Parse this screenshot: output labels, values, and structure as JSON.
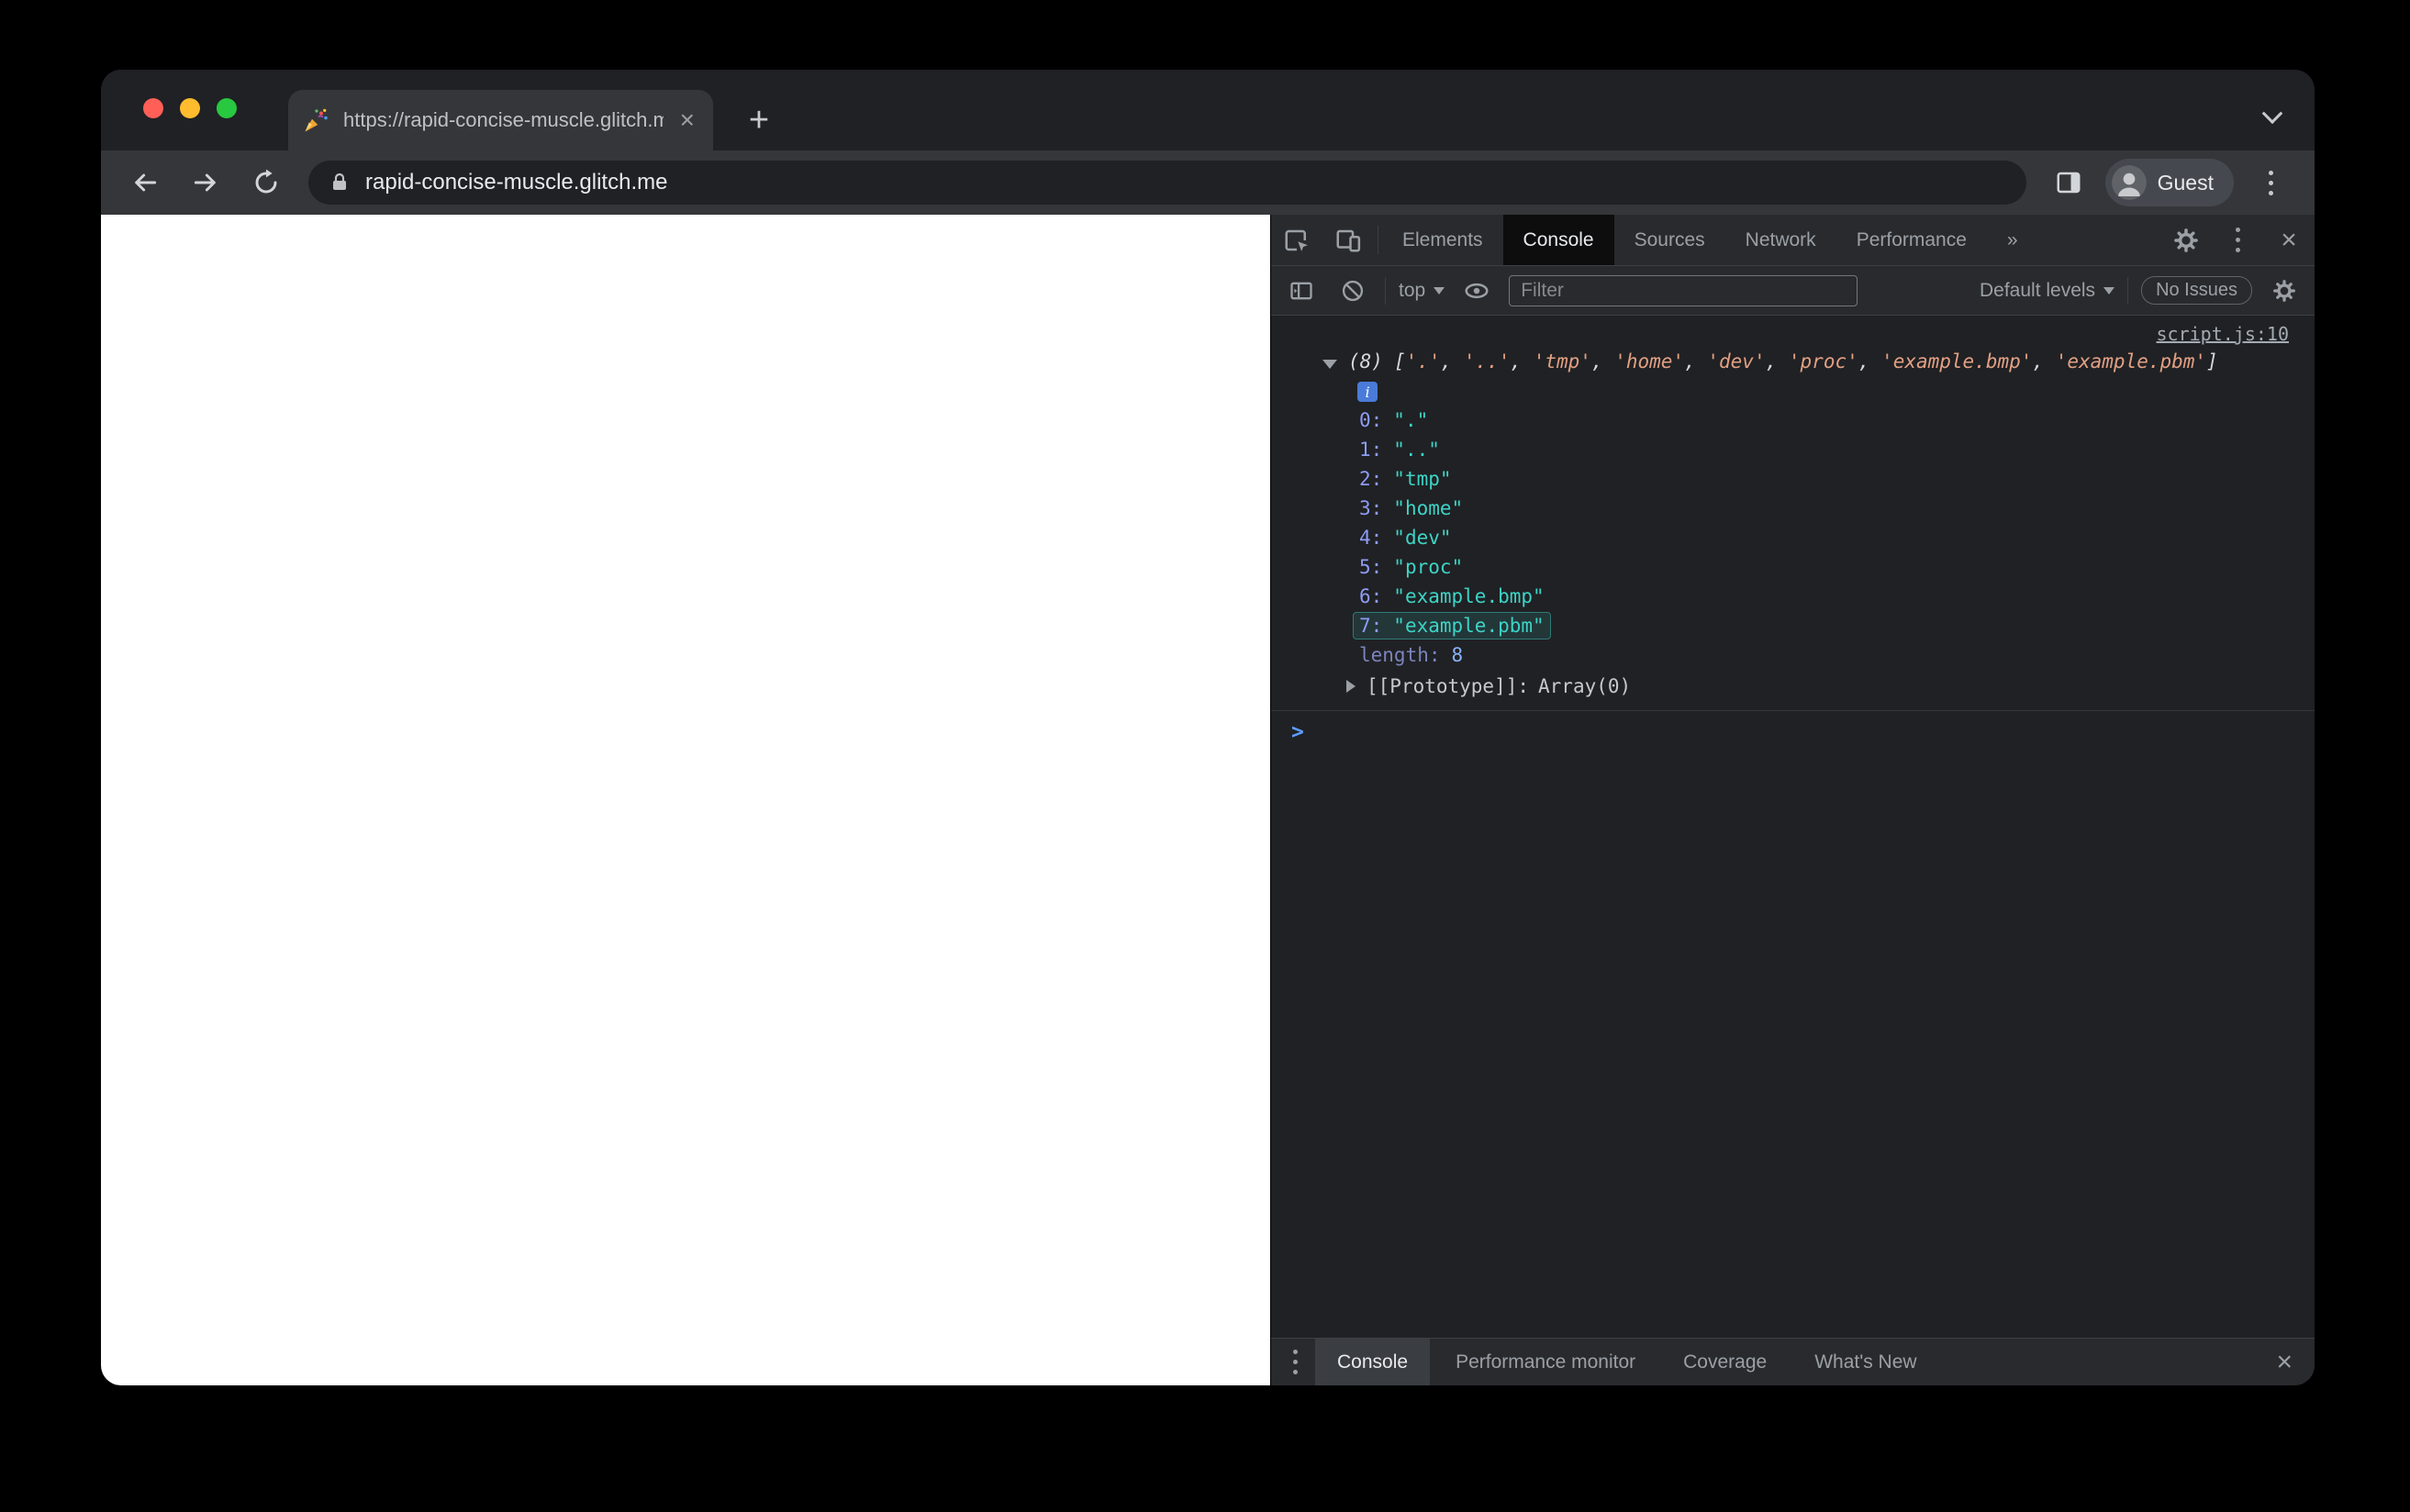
{
  "browser": {
    "tab_title": "https://rapid-concise-muscle.glitch.me",
    "url": "rapid-concise-muscle.glitch.me",
    "profile_label": "Guest"
  },
  "icons": {
    "tab_close": "×",
    "new_tab": "+",
    "devtools_close": "×",
    "drawer_close": "×"
  },
  "devtools": {
    "main_tabs": [
      "Elements",
      "Console",
      "Sources",
      "Network",
      "Performance"
    ],
    "more_tabs_symbol": "»",
    "active_main_tab": "Console",
    "console_toolbar": {
      "context_label": "top",
      "filter_placeholder": "Filter",
      "levels_label": "Default levels",
      "issues_label": "No Issues"
    },
    "console": {
      "source_link": "script.js:10",
      "array_count": "(8)",
      "open_bracket": "[",
      "close_bracket": "]",
      "comma": ", ",
      "preview_items": [
        "'.'",
        "'..'",
        "'tmp'",
        "'home'",
        "'dev'",
        "'proc'",
        "'example.bmp'",
        "'example.pbm'"
      ],
      "info_badge": "i",
      "entries": [
        {
          "key": "0:",
          "value": "\".\""
        },
        {
          "key": "1:",
          "value": "\"..\""
        },
        {
          "key": "2:",
          "value": "\"tmp\""
        },
        {
          "key": "3:",
          "value": "\"home\""
        },
        {
          "key": "4:",
          "value": "\"dev\""
        },
        {
          "key": "5:",
          "value": "\"proc\""
        },
        {
          "key": "6:",
          "value": "\"example.bmp\""
        },
        {
          "key": "7:",
          "value": "\"example.pbm\""
        }
      ],
      "length_key": "length:",
      "length_value": "8",
      "prototype_key": "[[Prototype]]:",
      "prototype_value": "Array(0)",
      "prompt_symbol": ">"
    },
    "drawer_tabs": [
      "Console",
      "Performance monitor",
      "Coverage",
      "What's New"
    ],
    "active_drawer_tab": "Console"
  }
}
